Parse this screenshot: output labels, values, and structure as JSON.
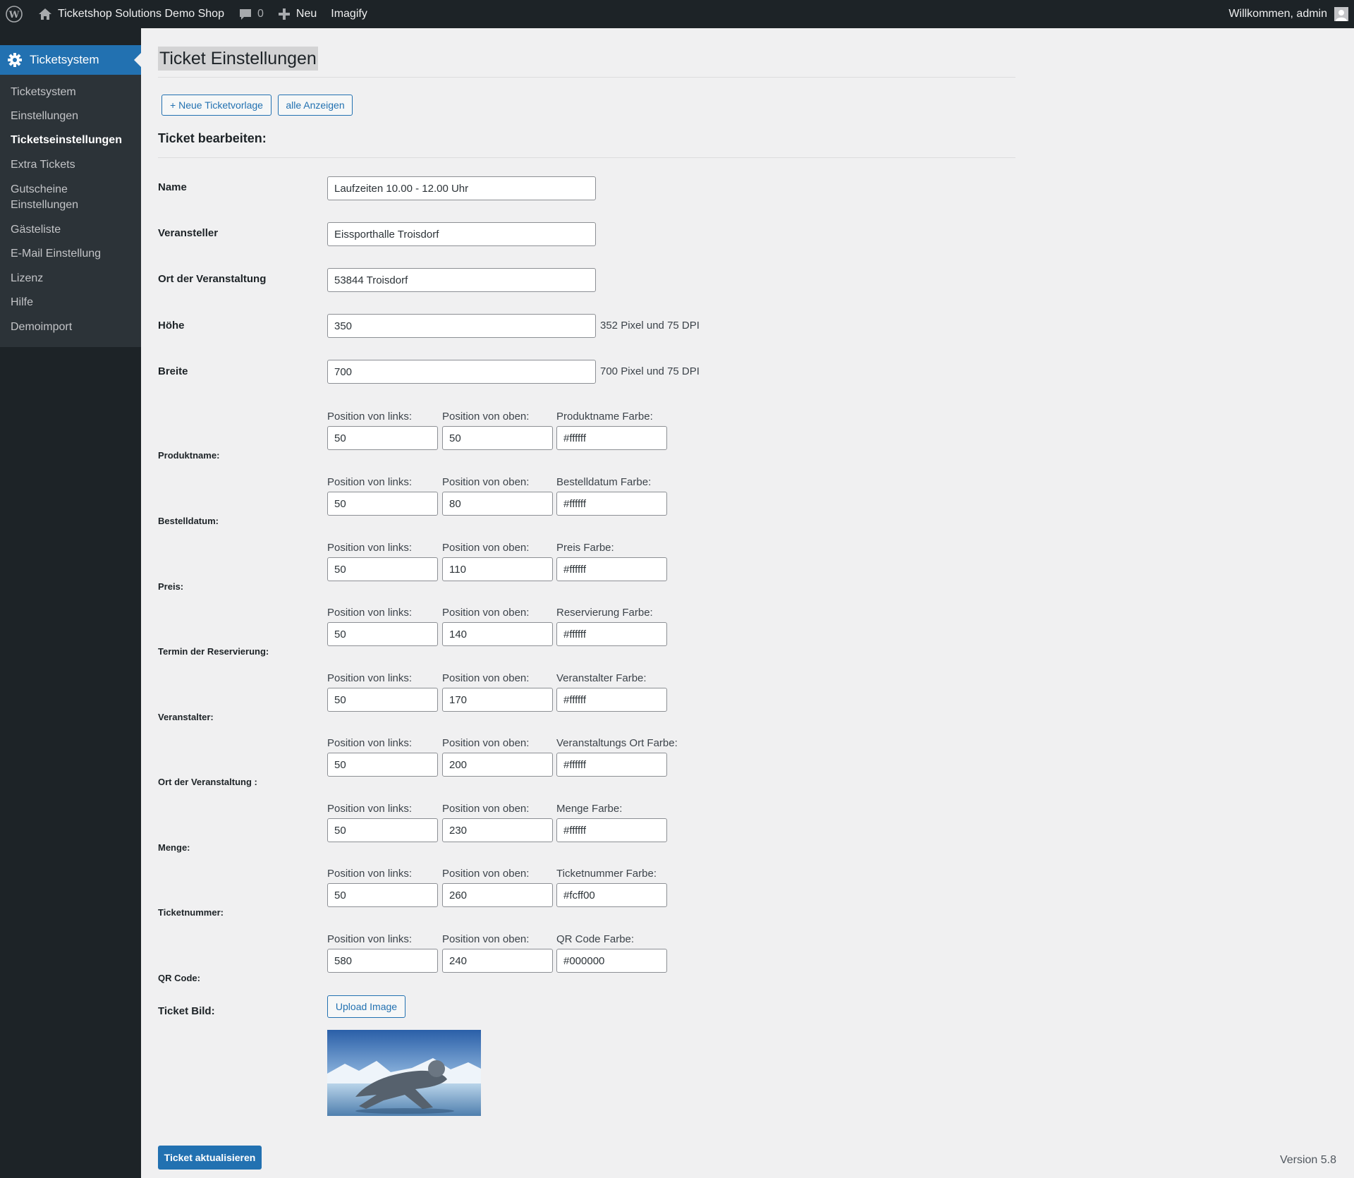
{
  "adminbar": {
    "site_name": "Ticketshop Solutions Demo Shop",
    "comments_count": "0",
    "new_label": "Neu",
    "imagify_label": "Imagify",
    "welcome": "Willkommen, admin"
  },
  "sidebar": {
    "current_menu": "Ticketsystem",
    "items": [
      {
        "label": "Ticketsystem"
      },
      {
        "label": "Einstellungen"
      },
      {
        "label": "Ticketseinstellungen"
      },
      {
        "label": "Extra Tickets"
      },
      {
        "label": "Gutscheine Einstellungen"
      },
      {
        "label": "Gästeliste"
      },
      {
        "label": "E-Mail Einstellung"
      },
      {
        "label": "Lizenz"
      },
      {
        "label": "Hilfe"
      },
      {
        "label": "Demoimport"
      }
    ]
  },
  "page": {
    "title": "Ticket Einstellungen",
    "btn_new": "+ Neue Ticketvorlage",
    "btn_all": "alle Anzeigen",
    "section_title": "Ticket bearbeiten:",
    "name_label": "Name",
    "name_value": "Laufzeiten 10.00 - 12.00 Uhr",
    "veranstalter_label": "Veransteller",
    "veranstalter_value": "Eissporthalle Troisdorf",
    "ort_label": "Ort der Veranstaltung",
    "ort_value": "53844 Troisdorf",
    "hoehe_label": "Höhe",
    "hoehe_value": "350",
    "hoehe_suffix": "352 Pixel und 75 DPI",
    "breite_label": "Breite",
    "breite_value": "700",
    "breite_suffix": "700 Pixel und 75 DPI",
    "pos_left_label": "Position von links:",
    "pos_top_label": "Position von oben:",
    "fields": [
      {
        "label": "Produktname:",
        "color_label": "Produktname Farbe:",
        "left": "50",
        "top": "50",
        "color": "#ffffff"
      },
      {
        "label": "Bestelldatum:",
        "color_label": "Bestelldatum Farbe:",
        "left": "50",
        "top": "80",
        "color": "#ffffff"
      },
      {
        "label": "Preis:",
        "color_label": "Preis Farbe:",
        "left": "50",
        "top": "110",
        "color": "#ffffff"
      },
      {
        "label": "Termin der Reservierung:",
        "color_label": "Reservierung Farbe:",
        "left": "50",
        "top": "140",
        "color": "#ffffff"
      },
      {
        "label": "Veranstalter:",
        "color_label": "Veranstalter Farbe:",
        "left": "50",
        "top": "170",
        "color": "#ffffff"
      },
      {
        "label": "Ort der Veranstaltung :",
        "color_label": "Veranstaltungs Ort Farbe:",
        "left": "50",
        "top": "200",
        "color": "#ffffff"
      },
      {
        "label": "Menge:",
        "color_label": "Menge Farbe:",
        "left": "50",
        "top": "230",
        "color": "#ffffff"
      },
      {
        "label": "Ticketnummer:",
        "color_label": "Ticketnummer Farbe:",
        "left": "50",
        "top": "260",
        "color": "#fcff00"
      },
      {
        "label": "QR Code:",
        "color_label": "QR Code Farbe:",
        "left": "580",
        "top": "240",
        "color": "#000000"
      }
    ],
    "ticket_bild_label": "Ticket Bild:",
    "upload_label": "Upload Image",
    "submit_label": "Ticket aktualisieren",
    "version": "Version 5.8"
  },
  "colors": {
    "adminbar_bg": "#1d2327",
    "sidebar_bg": "#1d2327",
    "submenu_bg": "#2c3338",
    "accent": "#2271b1",
    "page_bg": "#f0f0f1"
  },
  "icons": [
    "wordpress-icon",
    "home-icon",
    "comment-icon",
    "plus-icon",
    "gear-icon",
    "avatar-icon"
  ]
}
